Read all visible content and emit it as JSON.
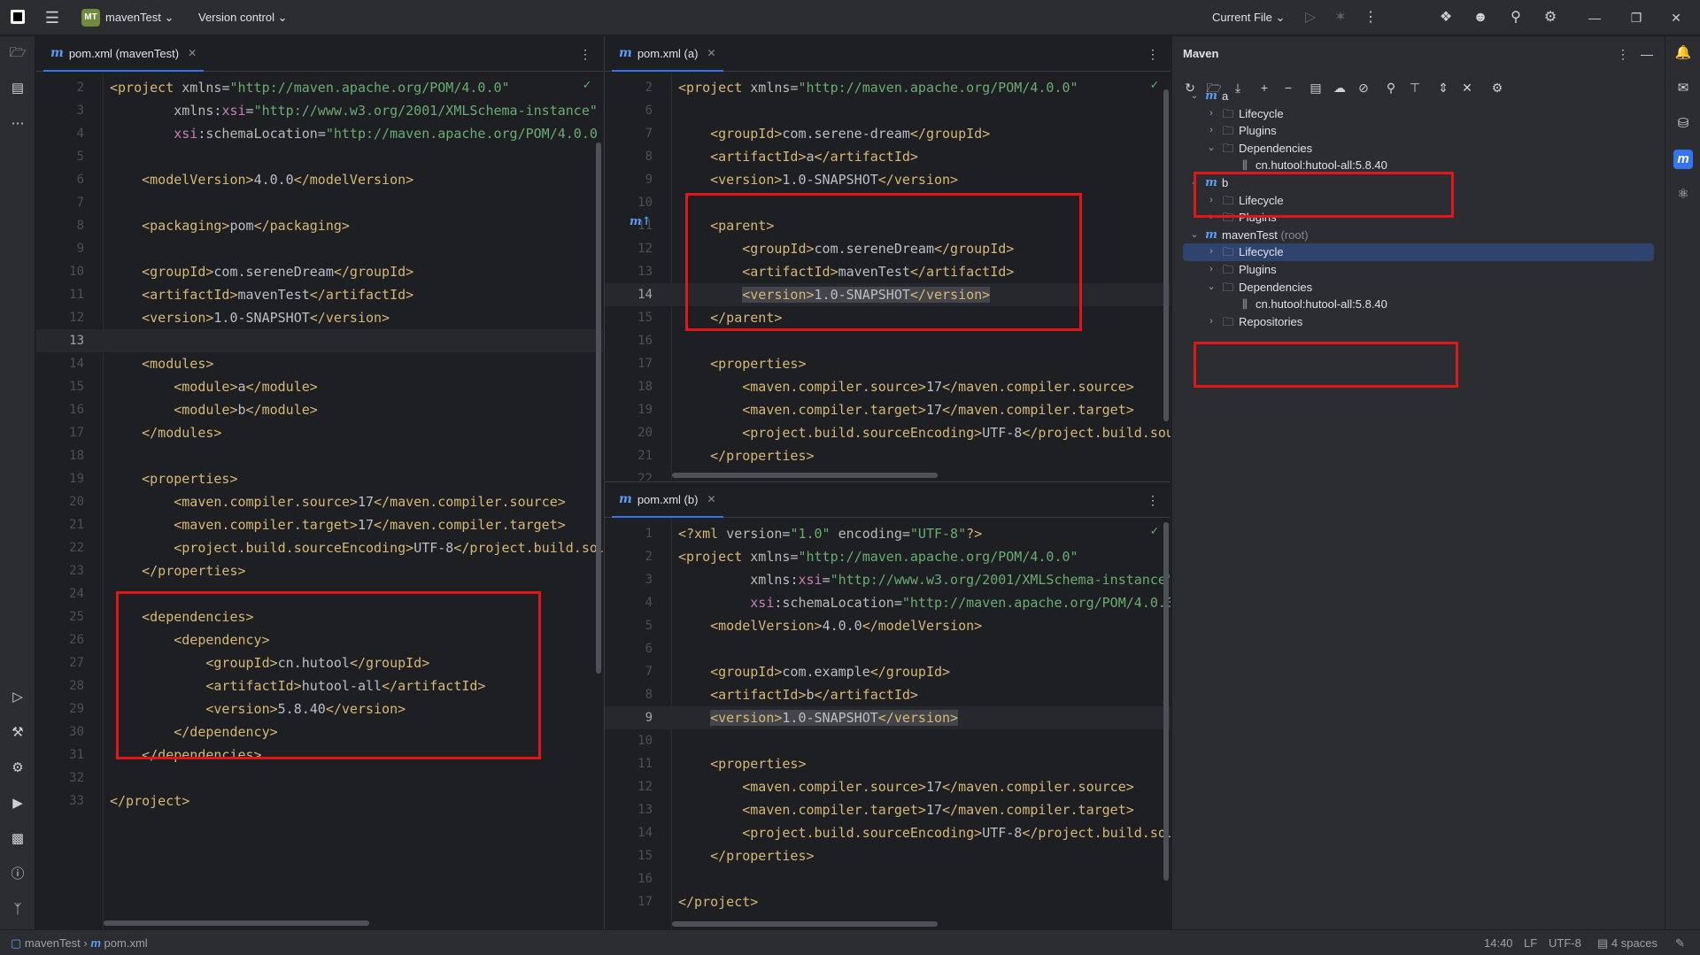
{
  "titlebar": {
    "project_badge": "MT",
    "project_name": "mavenTest",
    "version_control": "Version control",
    "run_config": "Current File"
  },
  "left_pane": {
    "tab_label": "pom.xml (mavenTest)",
    "lines": [
      {
        "n": "2",
        "html": "<span class='tag'>&lt;project</span> <span class='attr'>xmlns</span><span class='txt'>=</span><span class='str'>\"http://maven.apache.org/POM/4.0.0\"</span>"
      },
      {
        "n": "3",
        "html": "        <span class='attr'>xmlns</span><span class='txt'>:</span><span class='ns'>xsi</span><span class='txt'>=</span><span class='str'>\"http://www.w3.org/2001/XMLSchema-instance\"</span>"
      },
      {
        "n": "4",
        "html": "        <span class='ns'>xsi</span><span class='txt'>:</span><span class='attr'>schemaLocation</span><span class='txt'>=</span><span class='str'>\"http://maven.apache.org/POM/4.0.0</span>"
      },
      {
        "n": "5",
        "html": ""
      },
      {
        "n": "6",
        "html": "    <span class='tag'>&lt;modelVersion&gt;</span><span class='txt'>4.0.0</span><span class='tag'>&lt;/modelVersion&gt;</span>"
      },
      {
        "n": "7",
        "html": ""
      },
      {
        "n": "8",
        "html": "    <span class='tag'>&lt;packaging&gt;</span><span class='txt'>pom</span><span class='tag'>&lt;/packaging&gt;</span>"
      },
      {
        "n": "9",
        "html": ""
      },
      {
        "n": "10",
        "html": "    <span class='tag'>&lt;groupId&gt;</span><span class='txt'>com.sereneDream</span><span class='tag'>&lt;/groupId&gt;</span>"
      },
      {
        "n": "11",
        "html": "    <span class='tag'>&lt;artifactId&gt;</span><span class='txt'>mavenTest</span><span class='tag'>&lt;/artifactId&gt;</span>"
      },
      {
        "n": "12",
        "html": "    <span class='tag'>&lt;version&gt;</span><span class='txt'>1.0-SNAPSHOT</span><span class='tag'>&lt;/version&gt;</span>"
      },
      {
        "n": "13",
        "html": "",
        "current": true
      },
      {
        "n": "14",
        "html": "    <span class='tag'>&lt;modules&gt;</span>"
      },
      {
        "n": "15",
        "html": "        <span class='tag'>&lt;module&gt;</span><span class='txt'>a</span><span class='tag'>&lt;/module&gt;</span>"
      },
      {
        "n": "16",
        "html": "        <span class='tag'>&lt;module&gt;</span><span class='txt'>b</span><span class='tag'>&lt;/module&gt;</span>"
      },
      {
        "n": "17",
        "html": "    <span class='tag'>&lt;/modules&gt;</span>"
      },
      {
        "n": "18",
        "html": ""
      },
      {
        "n": "19",
        "html": "    <span class='tag'>&lt;properties&gt;</span>"
      },
      {
        "n": "20",
        "html": "        <span class='tag'>&lt;maven.compiler.source&gt;</span><span class='txt'>17</span><span class='tag'>&lt;/maven.compiler.source&gt;</span>"
      },
      {
        "n": "21",
        "html": "        <span class='tag'>&lt;maven.compiler.target&gt;</span><span class='txt'>17</span><span class='tag'>&lt;/maven.compiler.target&gt;</span>"
      },
      {
        "n": "22",
        "html": "        <span class='tag'>&lt;project.build.sourceEncoding&gt;</span><span class='txt'>UTF-8</span><span class='tag'>&lt;/project.build.sour</span>"
      },
      {
        "n": "23",
        "html": "    <span class='tag'>&lt;/properties&gt;</span>"
      },
      {
        "n": "24",
        "html": ""
      },
      {
        "n": "25",
        "html": "    <span class='tag'>&lt;dependencies&gt;</span>"
      },
      {
        "n": "26",
        "html": "        <span class='tag'>&lt;dependency&gt;</span>"
      },
      {
        "n": "27",
        "html": "            <span class='tag'>&lt;groupId&gt;</span><span class='txt'>cn.hutool</span><span class='tag'>&lt;/groupId&gt;</span>"
      },
      {
        "n": "28",
        "html": "            <span class='tag'>&lt;artifactId&gt;</span><span class='txt'>hutool-all</span><span class='tag'>&lt;/artifactId&gt;</span>"
      },
      {
        "n": "29",
        "html": "            <span class='tag'>&lt;version&gt;</span><span class='txt'>5.8.40</span><span class='tag'>&lt;/version&gt;</span>"
      },
      {
        "n": "30",
        "html": "        <span class='tag'>&lt;/dependency&gt;</span>"
      },
      {
        "n": "31",
        "html": "    <span class='tag'>&lt;/dependencies&gt;</span>"
      },
      {
        "n": "32",
        "html": ""
      },
      {
        "n": "33",
        "html": "<span class='tag'>&lt;/project&gt;</span>"
      }
    ]
  },
  "top_right_pane": {
    "tab_label": "pom.xml (a)",
    "lines": [
      {
        "n": "2",
        "html": "<span class='tag'>&lt;project</span> <span class='attr'>xmlns</span><span class='txt'>=</span><span class='str'>\"http://maven.apache.org/POM/4.0.0\"</span>"
      },
      {
        "n": "6",
        "html": ""
      },
      {
        "n": "7",
        "html": "    <span class='tag'>&lt;groupId&gt;</span><span class='txt'>com.serene-dream</span><span class='tag'>&lt;/groupId&gt;</span>"
      },
      {
        "n": "8",
        "html": "    <span class='tag'>&lt;artifactId&gt;</span><span class='txt'>a</span><span class='tag'>&lt;/artifactId&gt;</span>"
      },
      {
        "n": "9",
        "html": "    <span class='tag'>&lt;version&gt;</span><span class='txt'>1.0-SNAPSHOT</span><span class='tag'>&lt;/version&gt;</span>"
      },
      {
        "n": "10",
        "html": ""
      },
      {
        "n": "11",
        "html": "    <span class='tag'>&lt;parent&gt;</span>"
      },
      {
        "n": "12",
        "html": "        <span class='tag'>&lt;groupId&gt;</span><span class='txt'>com.sereneDream</span><span class='tag'>&lt;/groupId&gt;</span>"
      },
      {
        "n": "13",
        "html": "        <span class='tag'>&lt;artifactId&gt;</span><span class='txt'>mavenTest</span><span class='tag'>&lt;/artifactId&gt;</span>"
      },
      {
        "n": "14",
        "html": "        <span class='tag hl'>&lt;version&gt;</span><span class='txt hl'>1.0-SNAPSHOT</span><span class='tag hl'>&lt;/version&gt;</span>",
        "current": true
      },
      {
        "n": "15",
        "html": "    <span class='tag'>&lt;/parent&gt;</span>"
      },
      {
        "n": "16",
        "html": ""
      },
      {
        "n": "17",
        "html": "    <span class='tag'>&lt;properties&gt;</span>"
      },
      {
        "n": "18",
        "html": "        <span class='tag'>&lt;maven.compiler.source&gt;</span><span class='txt'>17</span><span class='tag'>&lt;/maven.compiler.source&gt;</span>"
      },
      {
        "n": "19",
        "html": "        <span class='tag'>&lt;maven.compiler.target&gt;</span><span class='txt'>17</span><span class='tag'>&lt;/maven.compiler.target&gt;</span>"
      },
      {
        "n": "20",
        "html": "        <span class='tag'>&lt;project.build.sourceEncoding&gt;</span><span class='txt'>UTF-8</span><span class='tag'>&lt;/project.build.sour</span>"
      },
      {
        "n": "21",
        "html": "    <span class='tag'>&lt;/properties&gt;</span>"
      },
      {
        "n": "22",
        "html": ""
      }
    ]
  },
  "bottom_right_pane": {
    "tab_label": "pom.xml (b)",
    "lines": [
      {
        "n": "1",
        "html": "<span class='tag'>&lt;?xml</span> <span class='attr'>version</span><span class='txt'>=</span><span class='str'>\"1.0\"</span> <span class='attr'>encoding</span><span class='txt'>=</span><span class='str'>\"UTF-8\"</span><span class='tag'>?&gt;</span>"
      },
      {
        "n": "2",
        "html": "<span class='tag'>&lt;project</span> <span class='attr'>xmlns</span><span class='txt'>=</span><span class='str'>\"http://maven.apache.org/POM/4.0.0\"</span>"
      },
      {
        "n": "3",
        "html": "         <span class='attr'>xmlns</span><span class='txt'>:</span><span class='ns'>xsi</span><span class='txt'>=</span><span class='str'>\"http://www.w3.org/2001/XMLSchema-instance\"</span>"
      },
      {
        "n": "4",
        "html": "         <span class='ns'>xsi</span><span class='txt'>:</span><span class='attr'>schemaLocation</span><span class='txt'>=</span><span class='str'>\"http://maven.apache.org/POM/4.0.0</span>"
      },
      {
        "n": "5",
        "html": "    <span class='tag'>&lt;modelVersion&gt;</span><span class='txt'>4.0.0</span><span class='tag'>&lt;/modelVersion&gt;</span>"
      },
      {
        "n": "6",
        "html": ""
      },
      {
        "n": "7",
        "html": "    <span class='tag'>&lt;groupId&gt;</span><span class='txt'>com.example</span><span class='tag'>&lt;/groupId&gt;</span>"
      },
      {
        "n": "8",
        "html": "    <span class='tag'>&lt;artifactId&gt;</span><span class='txt'>b</span><span class='tag'>&lt;/artifactId&gt;</span>"
      },
      {
        "n": "9",
        "html": "    <span class='tag hl'>&lt;version&gt;</span><span class='txt hl'>1.0-SNAPSHOT</span><span class='tag hl'>&lt;/version&gt;</span>",
        "current": true
      },
      {
        "n": "10",
        "html": ""
      },
      {
        "n": "11",
        "html": "    <span class='tag'>&lt;properties&gt;</span>"
      },
      {
        "n": "12",
        "html": "        <span class='tag'>&lt;maven.compiler.source&gt;</span><span class='txt'>17</span><span class='tag'>&lt;/maven.compiler.source&gt;</span>"
      },
      {
        "n": "13",
        "html": "        <span class='tag'>&lt;maven.compiler.target&gt;</span><span class='txt'>17</span><span class='tag'>&lt;/maven.compiler.target&gt;</span>"
      },
      {
        "n": "14",
        "html": "        <span class='tag'>&lt;project.build.sourceEncoding&gt;</span><span class='txt'>UTF-8</span><span class='tag'>&lt;/project.build.sour</span>"
      },
      {
        "n": "15",
        "html": "    <span class='tag'>&lt;/properties&gt;</span>"
      },
      {
        "n": "16",
        "html": ""
      },
      {
        "n": "17",
        "html": "<span class='tag'>&lt;/project&gt;</span>"
      }
    ]
  },
  "maven": {
    "title": "Maven",
    "tree": [
      {
        "depth": 0,
        "chev": "v",
        "icon": "m",
        "label": "a"
      },
      {
        "depth": 1,
        "chev": ">",
        "icon": "folder",
        "label": "Lifecycle"
      },
      {
        "depth": 1,
        "chev": ">",
        "icon": "folder",
        "label": "Plugins"
      },
      {
        "depth": 1,
        "chev": "v",
        "icon": "folder",
        "label": "Dependencies"
      },
      {
        "depth": 2,
        "chev": "",
        "icon": "lib",
        "label": "cn.hutool:hutool-all:5.8.40"
      },
      {
        "depth": 0,
        "chev": "v",
        "icon": "m",
        "label": "b"
      },
      {
        "depth": 1,
        "chev": ">",
        "icon": "folder",
        "label": "Lifecycle"
      },
      {
        "depth": 1,
        "chev": ">",
        "icon": "folder",
        "label": "Plugins"
      },
      {
        "depth": 0,
        "chev": "v",
        "icon": "m",
        "label": "mavenTest",
        "sub": "(root)"
      },
      {
        "depth": 1,
        "chev": ">",
        "icon": "folder",
        "label": "Lifecycle",
        "selected": true
      },
      {
        "depth": 1,
        "chev": ">",
        "icon": "folder",
        "label": "Plugins"
      },
      {
        "depth": 1,
        "chev": "v",
        "icon": "folder",
        "label": "Dependencies"
      },
      {
        "depth": 2,
        "chev": "",
        "icon": "lib",
        "label": "cn.hutool:hutool-all:5.8.40"
      },
      {
        "depth": 1,
        "chev": ">",
        "icon": "folder",
        "label": "Repositories"
      }
    ]
  },
  "statusbar": {
    "project": "mavenTest",
    "file": "pom.xml",
    "position": "14:40",
    "line_sep": "LF",
    "encoding": "UTF-8",
    "indent": "4 spaces"
  },
  "colors": {
    "accent": "#3574f0",
    "highlight_box": "#e0161b",
    "xml_tag": "#d5b778",
    "xml_string": "#6aab73"
  }
}
